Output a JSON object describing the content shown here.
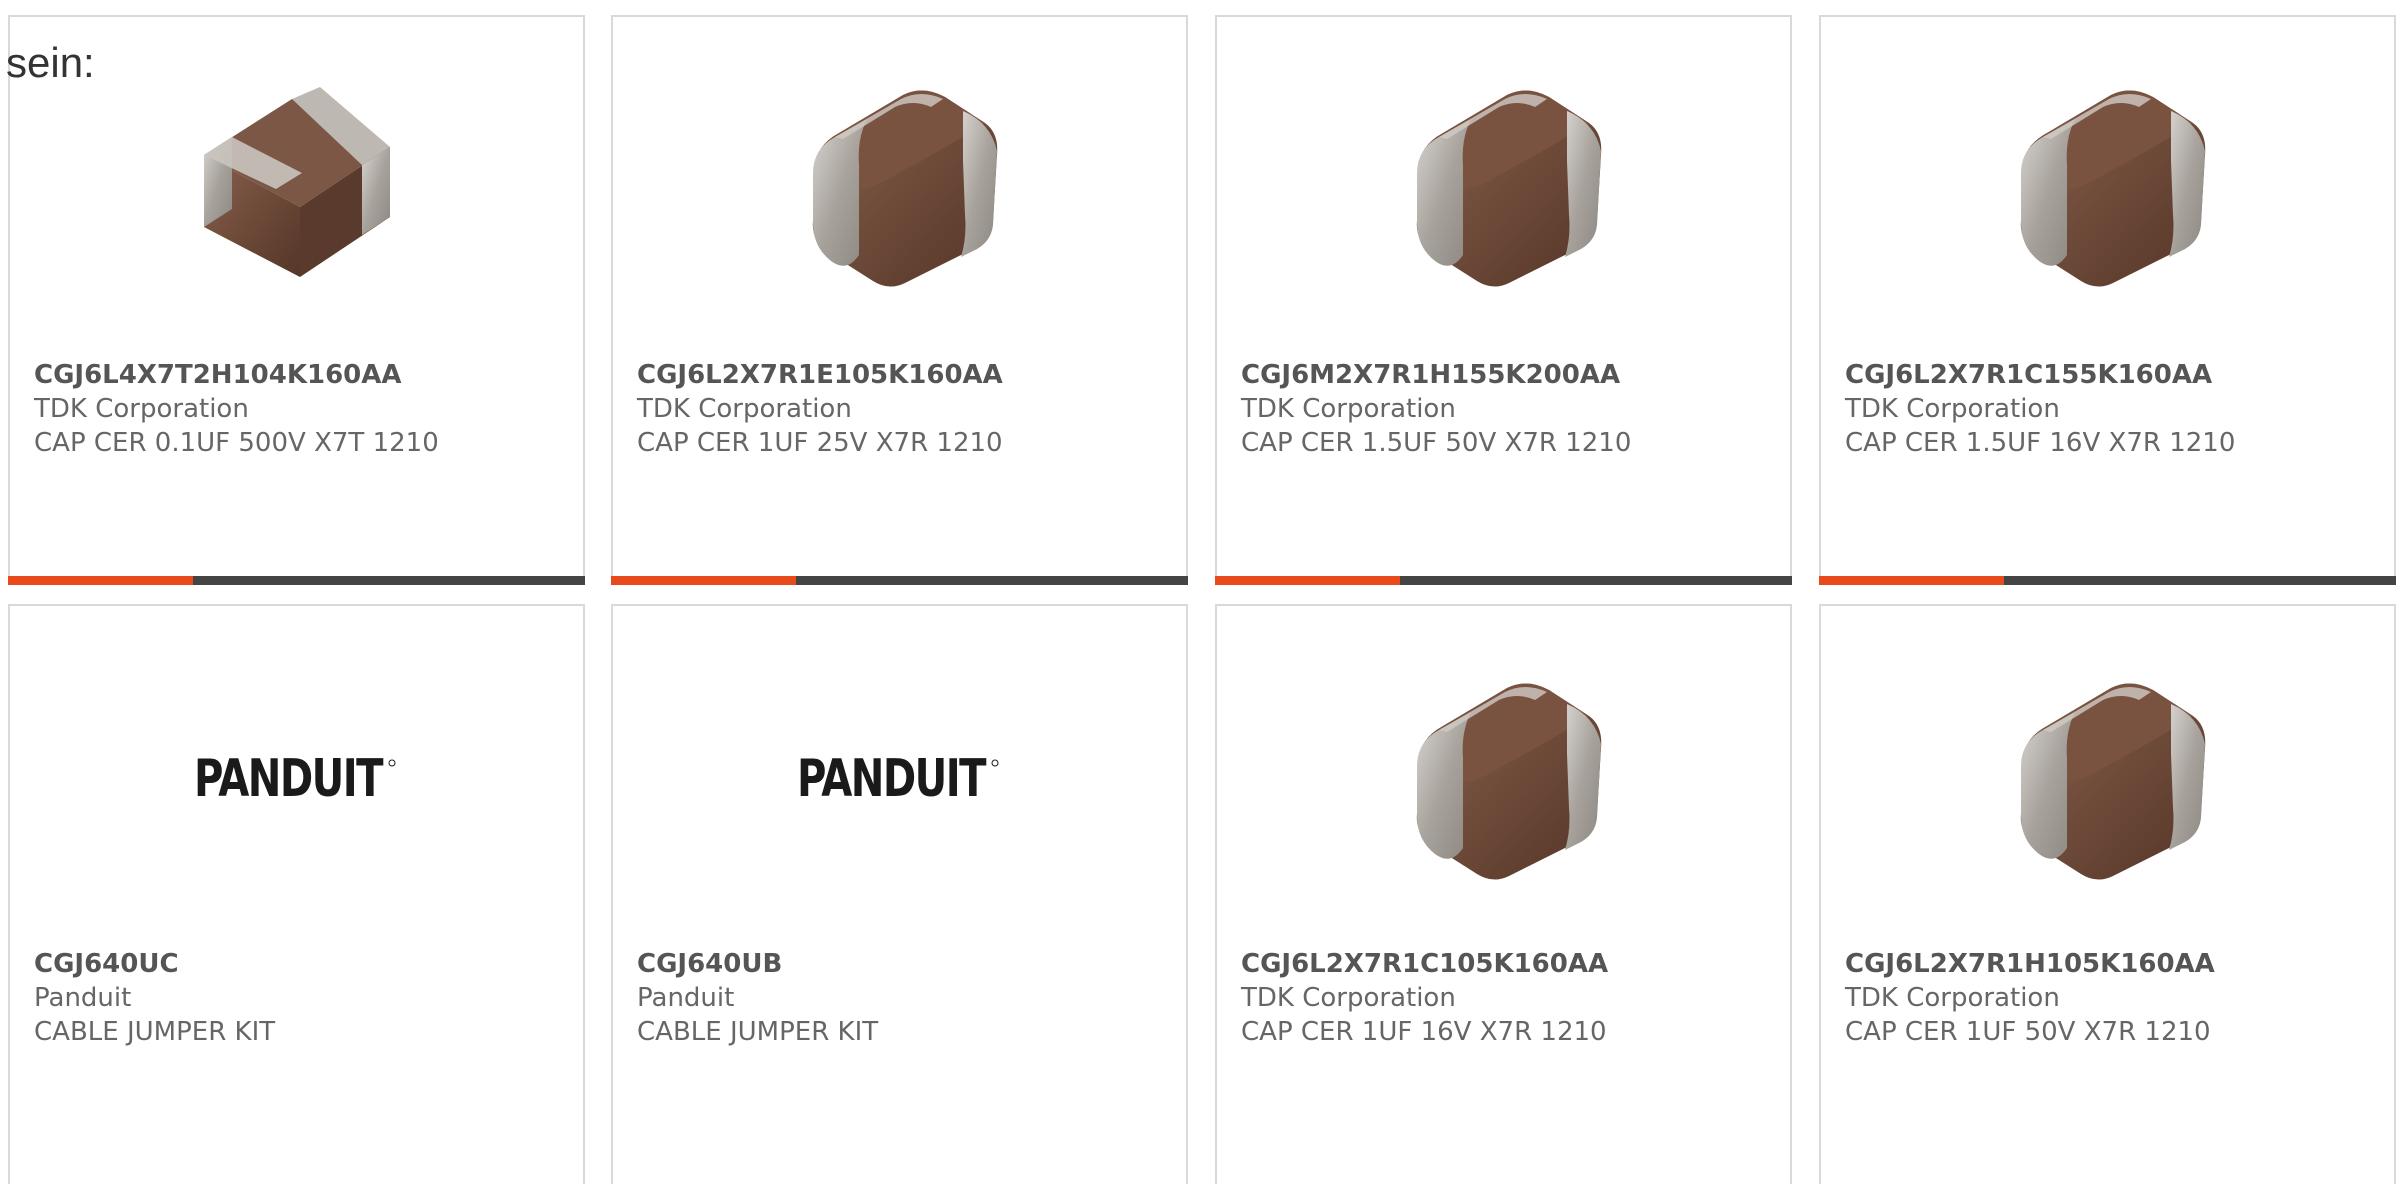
{
  "intro_text": "sein:",
  "colors": {
    "accent": "#e84a1b",
    "bar": "#444444",
    "border": "#d9d9d9"
  },
  "cards": [
    {
      "part": "CGJ6L4X7T2H104K160AA",
      "manufacturer": "TDK Corporation",
      "description": "CAP CER 0.1UF 500V X7T 1210",
      "image": "capacitor-chip"
    },
    {
      "part": "CGJ6L2X7R1E105K160AA",
      "manufacturer": "TDK Corporation",
      "description": "CAP CER 1UF 25V X7R 1210",
      "image": "capacitor-chip"
    },
    {
      "part": "CGJ6M2X7R1H155K200AA",
      "manufacturer": "TDK Corporation",
      "description": "CAP CER 1.5UF 50V X7R 1210",
      "image": "capacitor-chip"
    },
    {
      "part": "CGJ6L2X7R1C155K160AA",
      "manufacturer": "TDK Corporation",
      "description": "CAP CER 1.5UF 16V X7R 1210",
      "image": "capacitor-chip"
    },
    {
      "part": "CGJ640UC",
      "manufacturer": "Panduit",
      "description": "CABLE JUMPER KIT",
      "image": "panduit-logo",
      "logo_text": "PANDUIT"
    },
    {
      "part": "CGJ640UB",
      "manufacturer": "Panduit",
      "description": "CABLE JUMPER KIT",
      "image": "panduit-logo",
      "logo_text": "PANDUIT"
    },
    {
      "part": "CGJ6L2X7R1C105K160AA",
      "manufacturer": "TDK Corporation",
      "description": "CAP CER 1UF 16V X7R 1210",
      "image": "capacitor-chip"
    },
    {
      "part": "CGJ6L2X7R1H105K160AA",
      "manufacturer": "TDK Corporation",
      "description": "CAP CER 1UF 50V X7R 1210",
      "image": "capacitor-chip"
    }
  ]
}
